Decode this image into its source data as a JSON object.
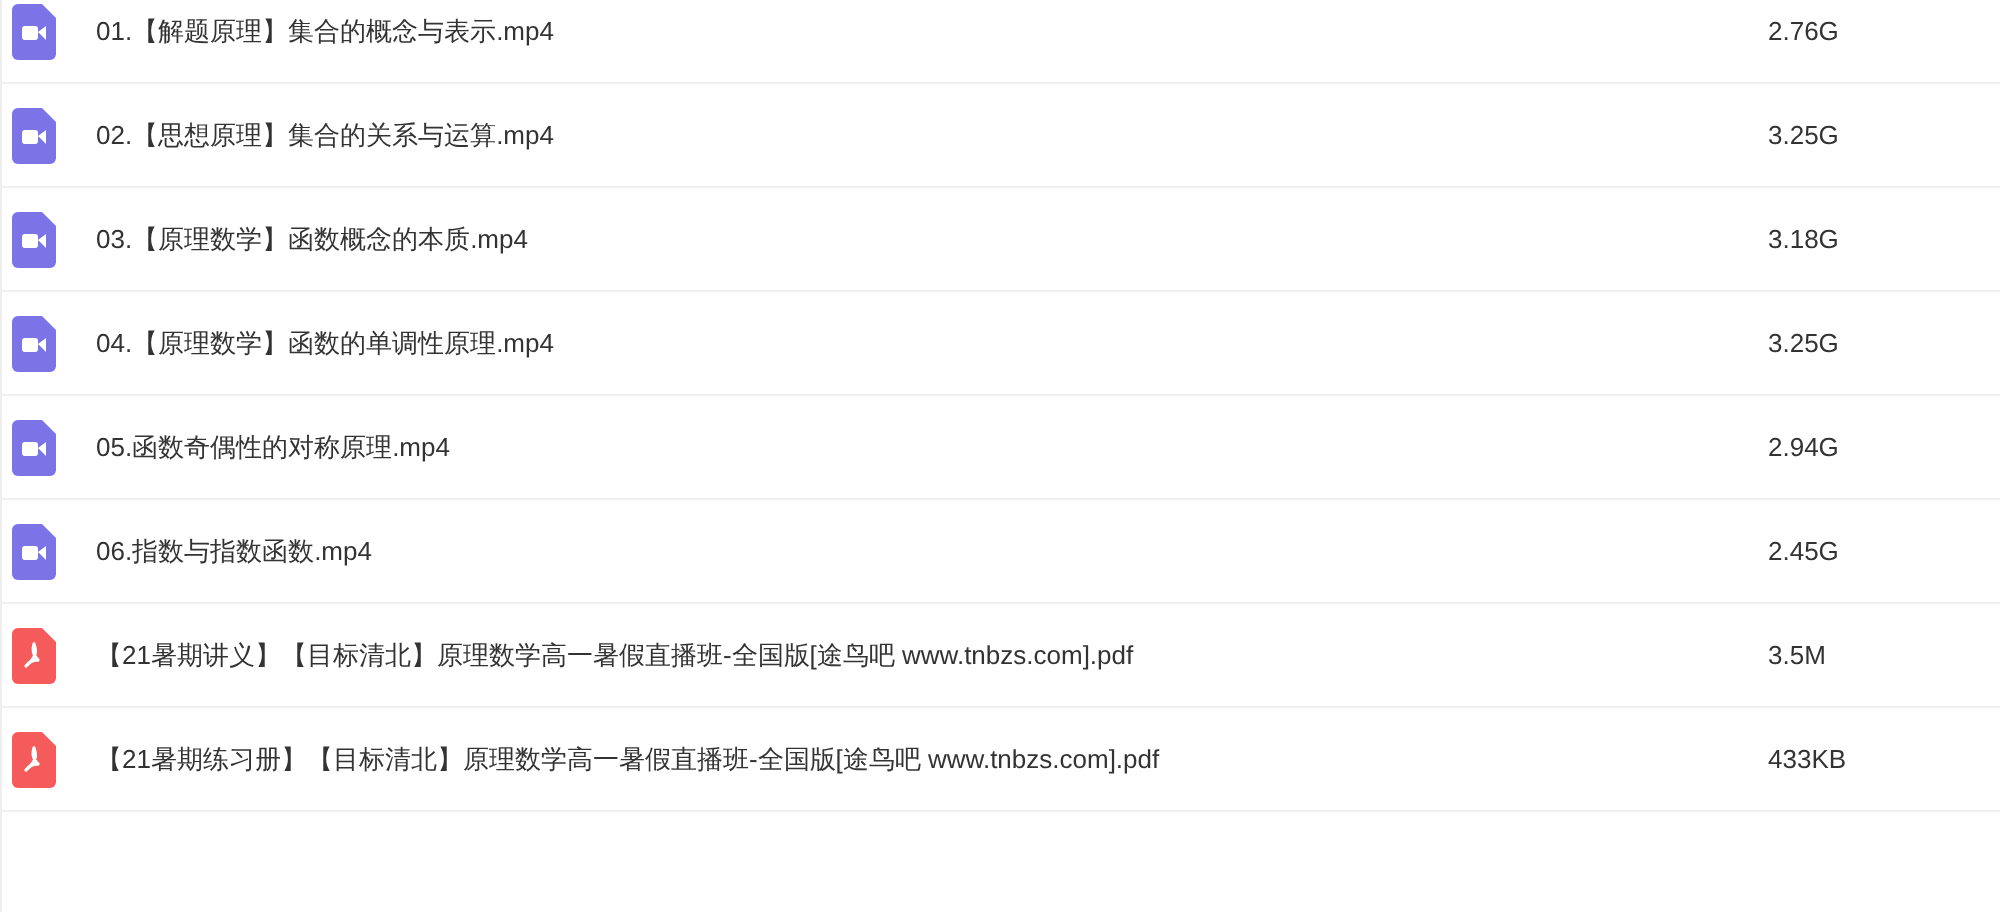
{
  "files": [
    {
      "kind": "video",
      "name": "01.【解题原理】集合的概念与表示.mp4",
      "size": "2.76G"
    },
    {
      "kind": "video",
      "name": "02.【思想原理】集合的关系与运算.mp4",
      "size": "3.25G"
    },
    {
      "kind": "video",
      "name": "03.【原理数学】函数概念的本质.mp4",
      "size": "3.18G"
    },
    {
      "kind": "video",
      "name": "04.【原理数学】函数的单调性原理.mp4",
      "size": "3.25G"
    },
    {
      "kind": "video",
      "name": "05.函数奇偶性的对称原理.mp4",
      "size": "2.94G"
    },
    {
      "kind": "video",
      "name": "06.指数与指数函数.mp4",
      "size": "2.45G"
    },
    {
      "kind": "pdf",
      "name": "【21暑期讲义】【目标清北】原理数学高一暑假直播班-全国版[途鸟吧 www.tnbzs.com].pdf",
      "size": "3.5M"
    },
    {
      "kind": "pdf",
      "name": "【21暑期练习册】【目标清北】原理数学高一暑假直播班-全国版[途鸟吧 www.tnbzs.com].pdf",
      "size": "433KB"
    }
  ]
}
